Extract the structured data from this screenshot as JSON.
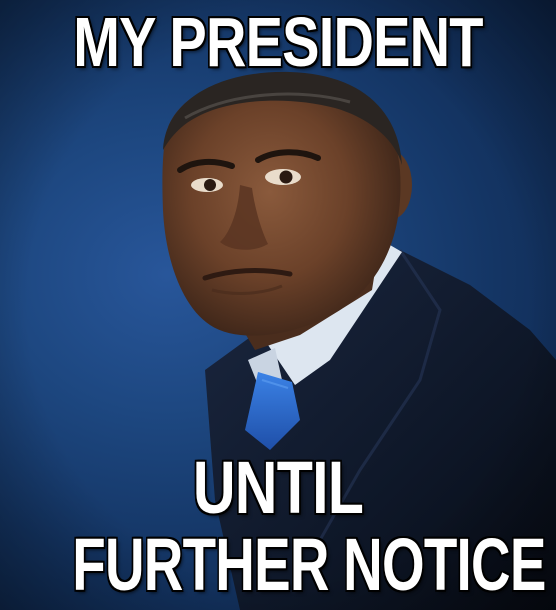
{
  "meme": {
    "top_text": "MY PRESIDENT",
    "bottom_text_line1": "UNTIL",
    "bottom_text_line2": "FURTHER NOTICE"
  },
  "colors": {
    "background": "#1d4780",
    "text": "#ffffff",
    "text_outline": "#000000",
    "suit": "#0f1726",
    "shirt": "#dde6f0",
    "tie": "#2f6fd6"
  }
}
